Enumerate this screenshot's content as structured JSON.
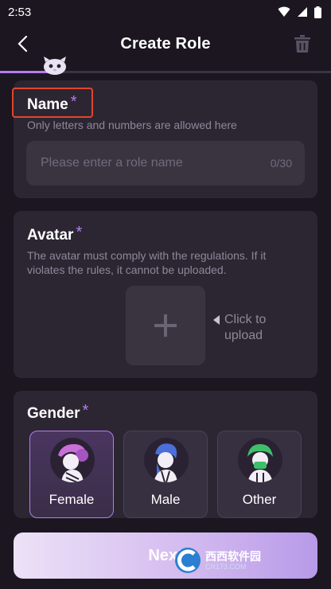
{
  "status_bar": {
    "time": "2:53"
  },
  "app_bar": {
    "title": "Create Role"
  },
  "progress": {
    "fraction": 0.17
  },
  "name_section": {
    "label": "Name",
    "required_mark": "*",
    "hint": "Only letters and numbers are allowed here",
    "input": {
      "value": "",
      "placeholder": "Please enter a role name"
    },
    "counter": "0/30"
  },
  "avatar_section": {
    "label": "Avatar",
    "required_mark": "*",
    "hint": "The avatar must comply with the regulations. If it violates the rules, it cannot be uploaded.",
    "upload_hint": "Click to upload"
  },
  "gender_section": {
    "label": "Gender",
    "required_mark": "*",
    "options": [
      {
        "label": "Female",
        "selected": true
      },
      {
        "label": "Male",
        "selected": false
      },
      {
        "label": "Other",
        "selected": false
      }
    ]
  },
  "next_button": {
    "label": "Next"
  },
  "watermark": {
    "brand": "西西软件园",
    "domain": "CR173.COM"
  },
  "colors": {
    "accent": "#b47cf0",
    "background": "#1b1620",
    "card": "#2c2633",
    "highlight": "#e2452d"
  }
}
